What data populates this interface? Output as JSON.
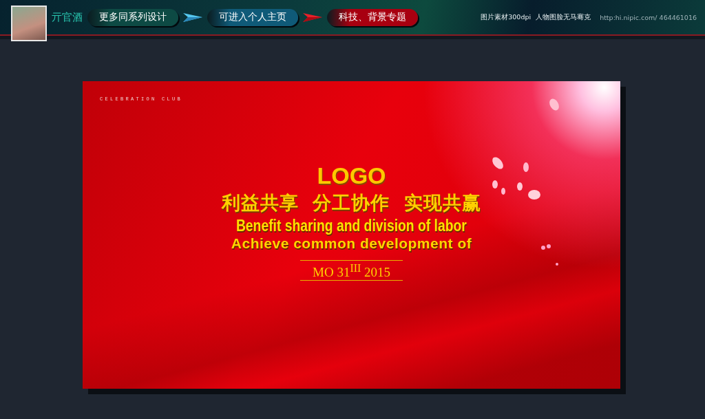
{
  "header": {
    "author_name": "亓官酒",
    "buttons": [
      {
        "label": "更多同系列设计",
        "color": "#0d4a44"
      },
      {
        "label": "可进入个人主页",
        "color": "#0f5a78"
      },
      {
        "label": "科技、背景专题",
        "color": "#a80010"
      }
    ],
    "notes": [
      "图片素材300dpi",
      "人物图脸无马骞克"
    ],
    "url": "http:hi.nipic.com/ 464461016"
  },
  "poster": {
    "tagline": "CELEBRATION CLUB",
    "logo": "LOGO",
    "headline": "利益共享  分工协作  实现共赢",
    "subtitle_1": "Benefit sharing and division of labor",
    "subtitle_2": "Achieve common development of",
    "date": "MO 31$^{III}$ 2015"
  }
}
